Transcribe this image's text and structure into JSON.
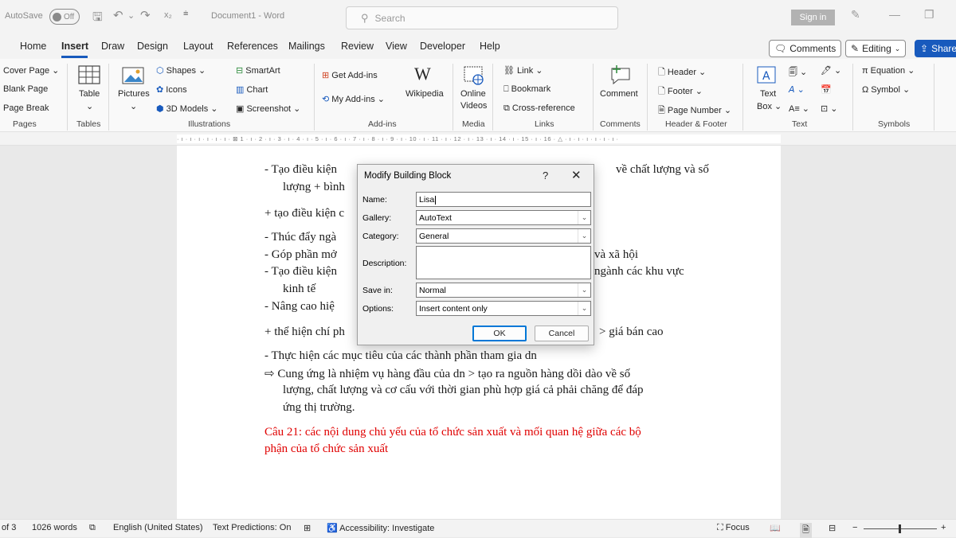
{
  "titlebar": {
    "autosave_label": "AutoSave",
    "autosave_state": "Off",
    "doc_title": "Document1  -  Word",
    "search_placeholder": "Search",
    "signin_label": "Sign in"
  },
  "menu": {
    "tabs": [
      "Home",
      "Insert",
      "Draw",
      "Design",
      "Layout",
      "References",
      "Mailings",
      "Review",
      "View",
      "Developer",
      "Help"
    ],
    "active_tab": "Insert",
    "comments_label": "Comments",
    "editing_label": "Editing",
    "share_label": "Share"
  },
  "ribbon": {
    "pages": {
      "items": [
        "Cover Page",
        "Blank Page",
        "Page Break"
      ],
      "group": "Pages"
    },
    "tables": {
      "table": "Table",
      "group": "Tables"
    },
    "illustrations": {
      "pictures": "Pictures",
      "shapes": "Shapes",
      "icons": "Icons",
      "models": "3D Models",
      "smartart": "SmartArt",
      "chart": "Chart",
      "screenshot": "Screenshot",
      "group": "Illustrations"
    },
    "addins": {
      "get": "Get Add-ins",
      "my": "My Add-ins",
      "wikipedia": "Wikipedia",
      "group": "Add-ins"
    },
    "media": {
      "online": "Online",
      "videos": "Videos",
      "group": "Media"
    },
    "links": {
      "link": "Link",
      "bookmark": "Bookmark",
      "crossref": "Cross-reference",
      "group": "Links"
    },
    "comments": {
      "comment": "Comment",
      "group": "Comments"
    },
    "headerfooter": {
      "header": "Header",
      "footer": "Footer",
      "pagenumber": "Page Number",
      "group": "Header & Footer"
    },
    "text": {
      "textbox1": "Text",
      "textbox2": "Box",
      "group": "Text"
    },
    "symbols": {
      "equation": "Equation",
      "symbol": "Symbol",
      "group": "Symbols"
    }
  },
  "ruler_text": "· ı · ı · ı · ı · ı · ı ·  ⊠ 1 · ı · 2 · ı · 3 · ı · 4 · ı · 5 · ı · 6 · ı · 7 · ı · 8 · ı · 9 · ı · 10 · ı · 11 · ı · 12 · ı · 13 · ı · 14 · ı · 15 · ı · 16 · △ · ı · ı · ı · ı · ı · ı ·",
  "document": {
    "lines": [
      {
        "text": "-   Tạo điều kiện",
        "red": false
      },
      {
        "text": "về chất lượng và số",
        "red": false
      },
      {
        "text": "lượng + bình",
        "red": false
      },
      {
        "text": "+ tạo điều kiện c",
        "red": false
      },
      {
        "text": "-   Thúc đẩy ngà",
        "red": false
      },
      {
        "text": "-   Góp phần mở",
        "red": false
      },
      {
        "text": "và xã hội",
        "red": false
      },
      {
        "text": "-   Tạo điều kiện",
        "red": false
      },
      {
        "text": "ngành các khu vực",
        "red": false
      },
      {
        "text": "kinh tế",
        "red": false
      },
      {
        "text": "-   Nâng cao hiệ",
        "red": false
      },
      {
        "text": "+ thể hiện chí ph",
        "red": false
      },
      {
        "text": "> giá bán cao",
        "red": false
      },
      {
        "text": "-   Thực hiện các mục tiêu của các thành phần tham gia dn",
        "red": false
      },
      {
        "text": "⇨  Cung ứng là nhiệm vụ hàng đầu của dn > tạo ra nguồn hàng dồi dào về số",
        "red": false
      },
      {
        "text": "lượng, chất lượng và cơ cấu với thời gian phù hợp giá cả phải chăng để đáp",
        "red": false
      },
      {
        "text": "ứng thị trường.",
        "red": false
      },
      {
        "text": "Câu 21: các nội dung chủ yếu của tổ chức sản xuất và mối quan hệ giữa các bộ",
        "red": true
      },
      {
        "text": "phận của tổ chức sản xuất",
        "red": true
      }
    ]
  },
  "dialog": {
    "title": "Modify Building Block",
    "help": "?",
    "name_label": "Name:",
    "name_value": "Lisa",
    "gallery_label": "Gallery:",
    "gallery_value": "AutoText",
    "category_label": "Category:",
    "category_value": "General",
    "description_label": "Description:",
    "description_value": "",
    "savein_label": "Save in:",
    "savein_value": "Normal",
    "options_label": "Options:",
    "options_value": "Insert content only",
    "ok_label": "OK",
    "cancel_label": "Cancel"
  },
  "status": {
    "page": "of 3",
    "words": "1026 words",
    "language": "English (United States)",
    "predictions": "Text Predictions: On",
    "accessibility": "Accessibility: Investigate",
    "focus": "Focus",
    "zoom_minus": "−",
    "zoom_plus": "+"
  },
  "colors": {
    "accent": "#185abd",
    "red_text": "#e00000"
  }
}
